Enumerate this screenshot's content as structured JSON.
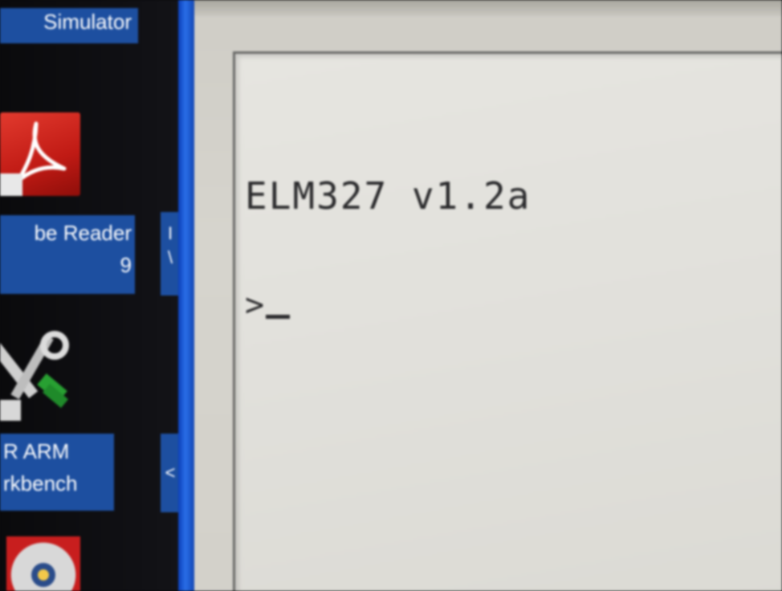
{
  "desktop": {
    "icons": [
      {
        "label": "Simulator"
      },
      {
        "label_line1": "be Reader",
        "label_line2": "9"
      },
      {
        "label_line1": "R ARM",
        "label_line2": "rkbench"
      }
    ],
    "slivers": [
      {
        "text": "I\n\\"
      },
      {
        "text": "<"
      }
    ]
  },
  "terminal": {
    "banner": "ELM327 v1.2a",
    "prompt": ">"
  },
  "colors": {
    "desktop_label_bg": "#1d4fa0",
    "taskbar_blue": "#2a6ee8",
    "terminal_bg": "#e3e2dd",
    "terminal_text": "#2a2a2c"
  }
}
